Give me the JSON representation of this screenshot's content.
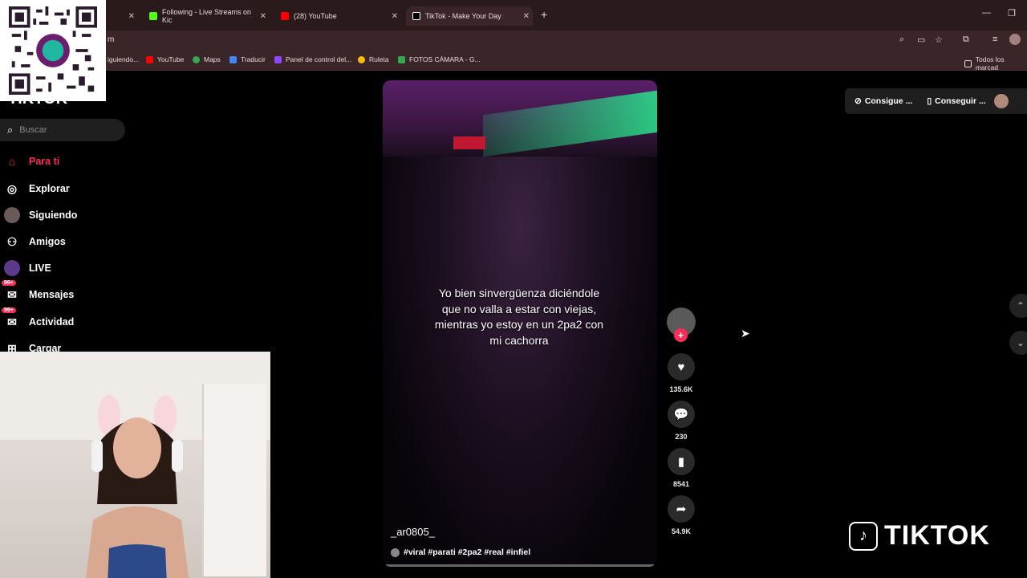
{
  "browser": {
    "tabs": [
      {
        "label": "",
        "favicon_color": "#888888"
      },
      {
        "label": "Following - Live Streams on Kic",
        "favicon_color": "#53fc18"
      },
      {
        "label": "(28) YouTube",
        "favicon_color": "#ff0000"
      },
      {
        "label": "TikTok - Make Your Day",
        "favicon_color": "#000000"
      }
    ],
    "address_text": "m",
    "bookmarks": [
      {
        "label": "iguiendo...",
        "color": "#9146ff"
      },
      {
        "label": "YouTube",
        "color": "#ff0000"
      },
      {
        "label": "Maps",
        "color": "#34a853"
      },
      {
        "label": "Traducir",
        "color": "#4285f4"
      },
      {
        "label": "Panel de control del...",
        "color": "#9146ff"
      },
      {
        "label": "Ruleta",
        "color": "#fbbc05"
      },
      {
        "label": "FOTOS CÁMARA - G...",
        "color": "#34a853"
      }
    ],
    "all_bookmarks_label": "Todos los marcad"
  },
  "overlay": {
    "qr_label": "yape"
  },
  "sidebar": {
    "logo": "TIKTOK",
    "search_placeholder": "Buscar",
    "items": [
      {
        "label": "Para ti",
        "icon": "home-icon",
        "glyph": "⌂",
        "active": true
      },
      {
        "label": "Explorar",
        "icon": "compass-icon",
        "glyph": "◎"
      },
      {
        "label": "Siguiendo",
        "icon": "following-avatar-icon",
        "glyph": "●"
      },
      {
        "label": "Amigos",
        "icon": "friends-icon",
        "glyph": "⚇"
      },
      {
        "label": "LIVE",
        "icon": "live-icon",
        "glyph": "●"
      },
      {
        "label": "Mensajes",
        "icon": "messages-icon",
        "glyph": "✉",
        "badge": "99+"
      },
      {
        "label": "Actividad",
        "icon": "activity-icon",
        "glyph": "✉",
        "badge": "99+"
      },
      {
        "label": "Cargar",
        "icon": "upload-icon",
        "glyph": "⊞"
      }
    ]
  },
  "video": {
    "caption": "Yo bien sinvergüenza diciéndole que no valla a estar con viejas, mientras yo estoy en un 2pa2 con mi cachorra",
    "username": "_ar0805_",
    "hashtags": "#viral #parati #2pa2 #real #infiel"
  },
  "actions": {
    "likes": "135.6K",
    "comments": "230",
    "saves": "8541",
    "shares": "54.9K"
  },
  "top_right": {
    "coins_label": "Consigue ...",
    "app_label": "Conseguir ..."
  },
  "watermark": {
    "text": "TIKTOK"
  },
  "colors": {
    "accent": "#fe2c55",
    "background": "#000000",
    "chrome": "#3a2628"
  }
}
